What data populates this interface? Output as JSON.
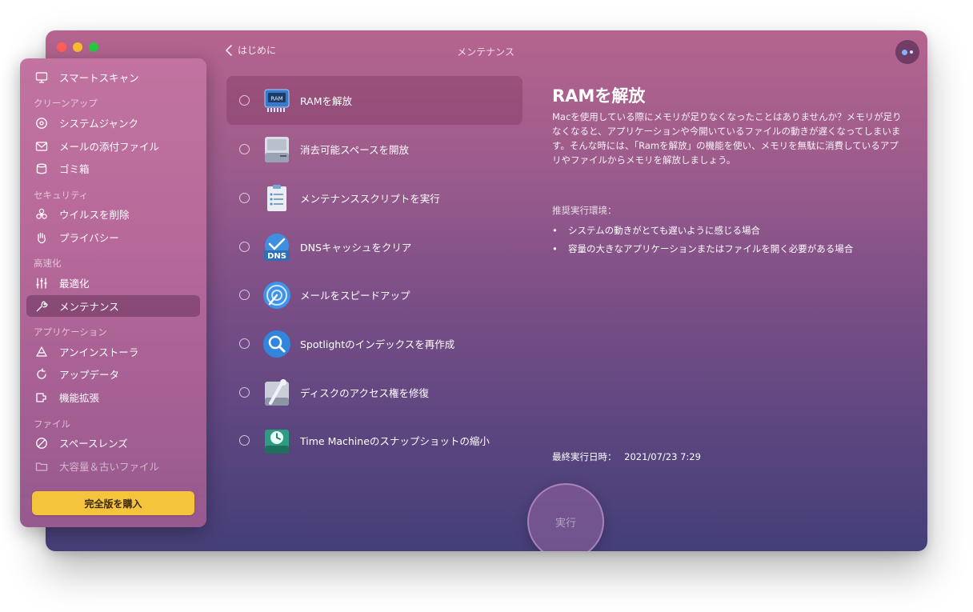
{
  "window": {
    "title": "メンテナンス",
    "back_label": "はじめに"
  },
  "sidebar": {
    "items": [
      {
        "label": "スマートスキャン",
        "icon": "monitor-icon"
      },
      {
        "label": "システムジャンク",
        "icon": "disc-icon"
      },
      {
        "label": "メールの添付ファイル",
        "icon": "envelope-icon"
      },
      {
        "label": "ゴミ箱",
        "icon": "trash-icon"
      },
      {
        "label": "ウイルスを削除",
        "icon": "biohazard-icon"
      },
      {
        "label": "プライバシー",
        "icon": "hand-icon"
      },
      {
        "label": "最適化",
        "icon": "sliders-icon"
      },
      {
        "label": "メンテナンス",
        "icon": "wrench-icon"
      },
      {
        "label": "アンインストーラ",
        "icon": "uninstaller-icon"
      },
      {
        "label": "アップデータ",
        "icon": "updater-icon"
      },
      {
        "label": "機能拡張",
        "icon": "extensions-icon"
      },
      {
        "label": "スペースレンズ",
        "icon": "space-lens-icon"
      },
      {
        "label": "大容量＆古いファイル",
        "icon": "folder-icon"
      }
    ],
    "sections": {
      "cleanup": "クリーンアップ",
      "security": "セキュリティ",
      "speed": "高速化",
      "applications": "アプリケーション",
      "files": "ファイル"
    },
    "buy_label": "完全版を購入"
  },
  "tasks": [
    {
      "label": "RAMを解放",
      "icon": "ram-chip-icon",
      "selected": true
    },
    {
      "label": "消去可能スペースを開放",
      "icon": "hard-drive-icon",
      "selected": false
    },
    {
      "label": "メンテナンススクリプトを実行",
      "icon": "clipboard-icon",
      "selected": false
    },
    {
      "label": "DNSキャッシュをクリア",
      "icon": "dns-icon",
      "selected": false
    },
    {
      "label": "メールをスピードアップ",
      "icon": "mail-speed-icon",
      "selected": false
    },
    {
      "label": "Spotlightのインデックスを再作成",
      "icon": "spotlight-icon",
      "selected": false
    },
    {
      "label": "ディスクのアクセス権を修復",
      "icon": "disk-permissions-icon",
      "selected": false
    },
    {
      "label": "Time Machineのスナップショットの縮小",
      "icon": "time-machine-icon",
      "selected": false
    }
  ],
  "detail": {
    "title": "RAMを解放",
    "description": "Macを使用している際にメモリが足りなくなったことはありませんか？メモリが足りなくなると、アプリケーションや今開いているファイルの動きが遅くなってしまいます。そんな時には、「Ramを解放」の機能を使い、メモリを無駄に消費しているアプリやファイルからメモリを解放しましょう。",
    "recommended_heading": "推奨実行環境：",
    "recommended": [
      "システムの動きがとても遅いように感じる場合",
      "容量の大きなアプリケーションまたはファイルを開く必要がある場合"
    ],
    "last_run_label": "最終実行日時：",
    "last_run_value": "2021/07/23 7:29"
  },
  "run_label": "実行",
  "bullet": "•",
  "ram_chip_text": "RAM",
  "dns_text": "DNS",
  "colors": {
    "buy_button": "#f4c43d",
    "window_top": "#b5648e",
    "window_bottom": "#443f77"
  }
}
